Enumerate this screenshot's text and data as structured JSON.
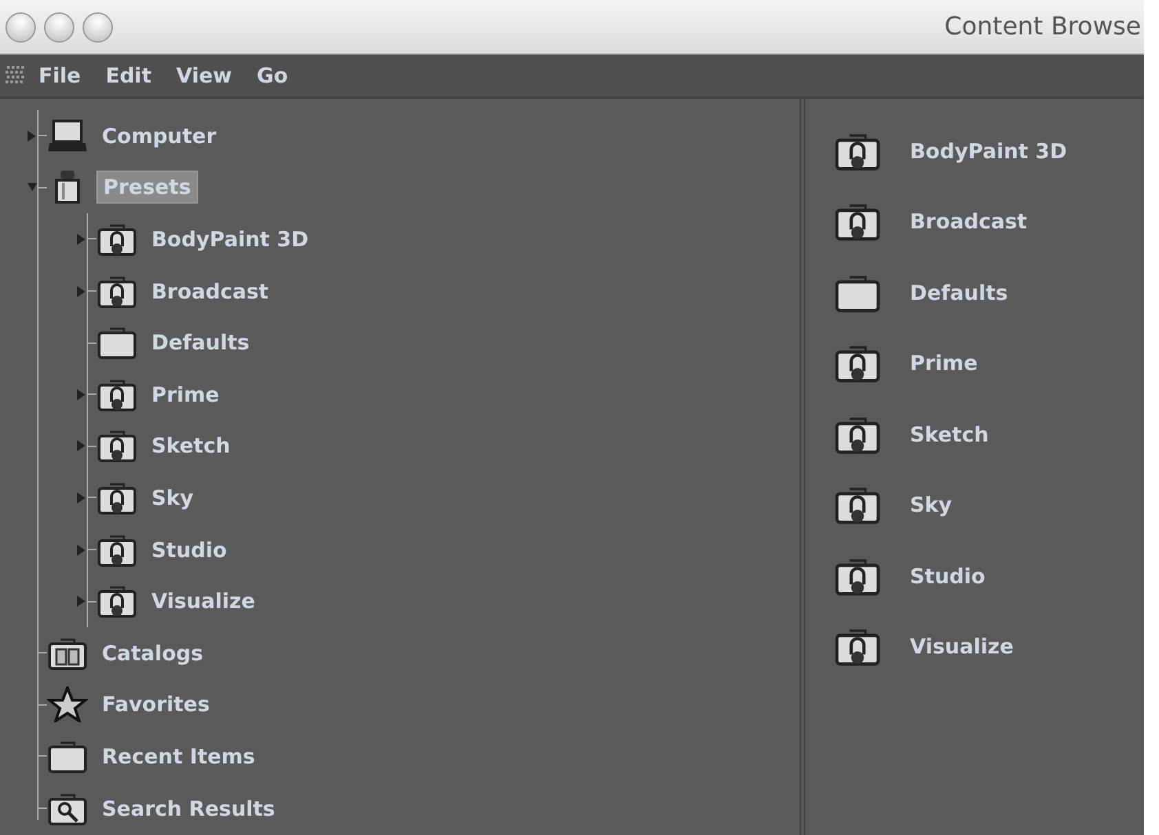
{
  "window": {
    "title": "Content Browse"
  },
  "menu": [
    "File",
    "Edit",
    "View",
    "Go"
  ],
  "tree": [
    {
      "label": "Computer",
      "kind": "computer",
      "expanded": false,
      "selected": false
    },
    {
      "label": "Presets",
      "kind": "presets",
      "expanded": true,
      "selected": true,
      "children": [
        {
          "label": "BodyPaint 3D",
          "kind": "locked",
          "expanded": false,
          "selected": false
        },
        {
          "label": "Broadcast",
          "kind": "locked",
          "expanded": false,
          "selected": false
        },
        {
          "label": "Defaults",
          "kind": "folder",
          "selected": false
        },
        {
          "label": "Prime",
          "kind": "locked",
          "expanded": false,
          "selected": false
        },
        {
          "label": "Sketch",
          "kind": "locked",
          "expanded": false,
          "selected": false
        },
        {
          "label": "Sky",
          "kind": "locked",
          "expanded": false,
          "selected": false
        },
        {
          "label": "Studio",
          "kind": "locked",
          "expanded": false,
          "selected": false
        },
        {
          "label": "Visualize",
          "kind": "locked",
          "expanded": false,
          "selected": false
        }
      ]
    },
    {
      "label": "Catalogs",
      "kind": "catalog",
      "selected": false
    },
    {
      "label": "Favorites",
      "kind": "star",
      "selected": false
    },
    {
      "label": "Recent Items",
      "kind": "folder",
      "selected": false
    },
    {
      "label": "Search Results",
      "kind": "search",
      "selected": false
    }
  ],
  "content": [
    {
      "label": "BodyPaint 3D",
      "kind": "locked"
    },
    {
      "label": "Broadcast",
      "kind": "locked"
    },
    {
      "label": "Defaults",
      "kind": "folder"
    },
    {
      "label": "Prime",
      "kind": "locked"
    },
    {
      "label": "Sketch",
      "kind": "locked"
    },
    {
      "label": "Sky",
      "kind": "locked"
    },
    {
      "label": "Studio",
      "kind": "locked"
    },
    {
      "label": "Visualize",
      "kind": "locked"
    }
  ]
}
